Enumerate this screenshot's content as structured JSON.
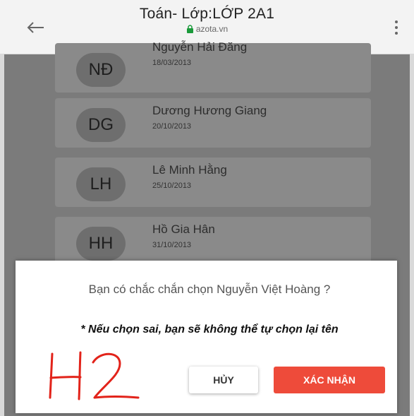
{
  "header": {
    "title": "Toán- Lớp:LỚP 2A1",
    "url": "azota.vn"
  },
  "students": [
    {
      "initials": "NĐ",
      "name": "Nguyễn Hải Đăng",
      "dob": "18/03/2013"
    },
    {
      "initials": "DG",
      "name": "Dương Hương Giang",
      "dob": "20/10/2013"
    },
    {
      "initials": "LH",
      "name": "Lê Minh Hằng",
      "dob": "25/10/2013"
    },
    {
      "initials": "HH",
      "name": "Hồ Gia Hân",
      "dob": "31/10/2013"
    }
  ],
  "dialog": {
    "question": "Bạn có chắc chắn chọn Nguyễn Việt Hoàng ?",
    "warning": "* Nếu chọn sai, bạn sẽ không thể tự chọn lại tên",
    "cancel_label": "HỦY",
    "confirm_label": "XÁC NHẬN",
    "annotation": "H2"
  },
  "colors": {
    "confirm": "#ee4b3a",
    "overlay": "#7b7b7b",
    "annotation": "#e2231a"
  }
}
